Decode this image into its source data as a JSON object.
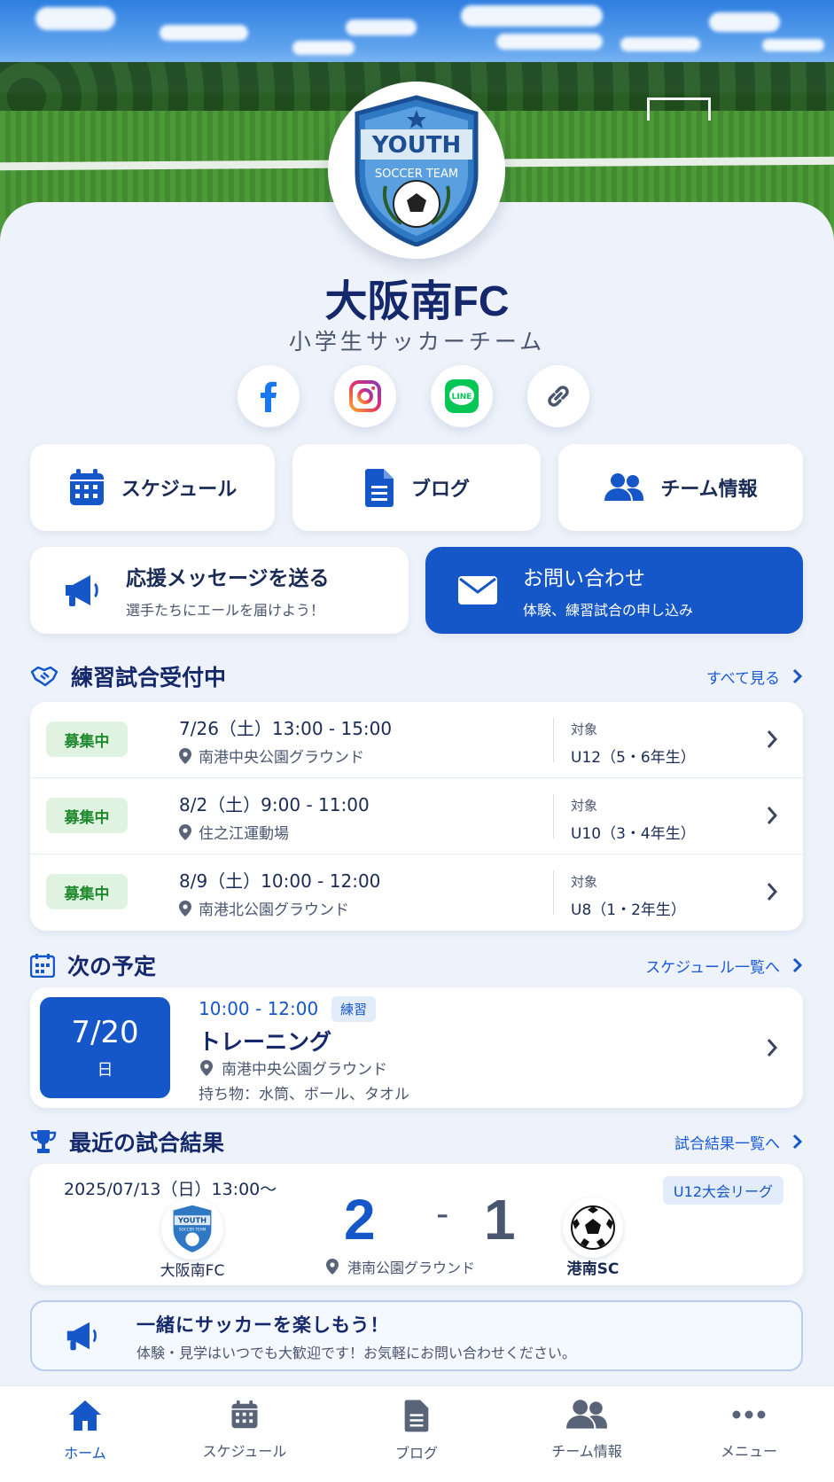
{
  "header": {
    "logo_top": "YOUTH",
    "logo_bottom": "SOCCER TEAM"
  },
  "team": {
    "name": "大阪南FC",
    "subtitle": "小学生サッカーチーム"
  },
  "social": [
    {
      "icon": "facebook-icon"
    },
    {
      "icon": "instagram-icon"
    },
    {
      "icon": "line-icon",
      "text": "LINE"
    },
    {
      "icon": "link-icon"
    }
  ],
  "quick": [
    {
      "label": "スケジュール",
      "icon": "calendar-icon"
    },
    {
      "label": "ブログ",
      "icon": "document-icon"
    },
    {
      "label": "チーム情報",
      "icon": "team-icon"
    }
  ],
  "support": {
    "title": "応援メッセージを送る",
    "sub": "選手たちにエールを届けよう！"
  },
  "contact": {
    "title": "お問い合わせ",
    "sub": "体験、練習試合の申し込み"
  },
  "practice": {
    "title": "練習試合受付中",
    "more": "すべて見る",
    "rows": [
      {
        "badge": "募集中",
        "datetime": "7/26（土）13:00 - 15:00",
        "place": "南港中央公園グラウンド",
        "target_label": "対象",
        "target": "U12（5・6年生）"
      },
      {
        "badge": "募集中",
        "datetime": "8/2（土）9:00 - 11:00",
        "place": "住之江運動場",
        "target_label": "対象",
        "target": "U10（3・4年生）"
      },
      {
        "badge": "募集中",
        "datetime": "8/9（土）10:00 - 12:00",
        "place": "南港北公園グラウンド",
        "target_label": "対象",
        "target": "U8（1・2年生）"
      }
    ]
  },
  "next": {
    "title": "次の予定",
    "more": "スケジュール一覧へ",
    "date": "7/20",
    "weekday": "日",
    "time": "10:00 - 12:00",
    "tag": "練習",
    "event": "トレーニング",
    "place": "南港中央公園グラウンド",
    "items": "持ち物：水筒、ボール、タオル"
  },
  "results": {
    "title": "最近の試合結果",
    "more": "試合結果一覧へ",
    "datetime": "2025/07/13（日）13:00〜",
    "league": "U12大会リーグ",
    "home": "大阪南FC",
    "home_score": "2",
    "dash": "-",
    "away_score": "1",
    "away": "港南SC",
    "place": "港南公園グラウンド"
  },
  "banner": {
    "title": "一緒にサッカーを楽しもう！",
    "sub": "体験・見学はいつでも大歓迎です！お気軽にお問い合わせください。"
  },
  "nav": [
    {
      "label": "ホーム",
      "icon": "home-icon",
      "active": true
    },
    {
      "label": "スケジュール",
      "icon": "calendar-icon"
    },
    {
      "label": "ブログ",
      "icon": "document-icon"
    },
    {
      "label": "チーム情報",
      "icon": "team-icon"
    },
    {
      "label": "メニュー",
      "icon": "more-icon"
    }
  ],
  "colors": {
    "primary": "#1556c8",
    "navy": "#14286b",
    "green_badge": "#dff3e0"
  }
}
